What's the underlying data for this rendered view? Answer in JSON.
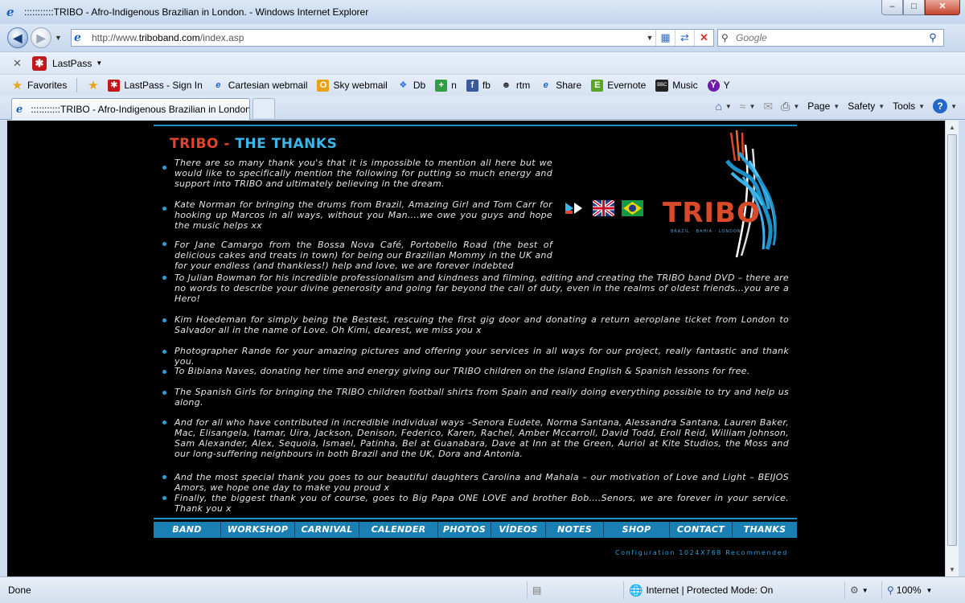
{
  "window": {
    "title": ":::::::::::TRIBO - Afro-Indigenous Brazilian in London. - Windows Internet Explorer",
    "buttons": {
      "minimize": "–",
      "maximize": "□",
      "close": "✕"
    }
  },
  "navbar": {
    "url_prefix": "http://www.",
    "url_domain": "triboband.com",
    "url_path": "/index.asp",
    "search_placeholder": "Google"
  },
  "lastpass": {
    "label": "LastPass"
  },
  "favorites": {
    "label": "Favorites",
    "items": [
      {
        "label": "LastPass - Sign In",
        "icon": "lastpass-icon"
      },
      {
        "label": "Cartesian webmail",
        "icon": "ie-page-icon"
      },
      {
        "label": "Sky webmail",
        "icon": "outlook-icon"
      },
      {
        "label": "Db",
        "icon": "dropbox-icon"
      },
      {
        "label": "n",
        "icon": "plus-icon"
      },
      {
        "label": "fb",
        "icon": "facebook-icon"
      },
      {
        "label": "rtm",
        "icon": "cow-icon"
      },
      {
        "label": "Share",
        "icon": "ie-page-icon"
      },
      {
        "label": "Evernote",
        "icon": "evernote-icon"
      },
      {
        "label": "Music",
        "icon": "bbc-icon"
      },
      {
        "label": "Y",
        "icon": "yahoo-icon"
      }
    ]
  },
  "tab": {
    "title": ":::::::::::TRIBO - Afro-Indigenous Brazilian in London..."
  },
  "commandbar": {
    "page": "Page",
    "safety": "Safety",
    "tools": "Tools"
  },
  "page": {
    "heading_part1": "TRIBO - ",
    "heading_part2": "THE THANKS",
    "logo_text": "TRIBO",
    "logo_subtext": "BRAZIL · BAHIA · LONDON",
    "thanks": [
      "There are so many thank you's that it is impossible to mention all here but we would like to specifically mention the following for putting so much energy and support into TRIBO and ultimately believing in the dream.",
      "Kate Norman for bringing the drums from Brazil, Amazing Girl and Tom Carr for hooking up Marcos in all ways, without you Man….we owe you guys and hope the music helps xx",
      "For Jane Camargo from the Bossa Nova Café, Portobello Road (the best of delicious cakes and treats in town) for being our Brazilian Mommy in the UK and for your endless (and thankless!) help and love, we are forever indebted",
      "To Julian Bowman for his incredible professionalism and kindness and filming, editing and creating the TRIBO band DVD – there are no words to describe your divine generosity and going far beyond the call of duty, even in the realms of oldest friends…you are a Hero!",
      "Kim Hoedeman for simply being the Bestest, rescuing the first gig door and donating a return aeroplane ticket from London to Salvador all in the name of Love. Oh Kimi, dearest, we miss you x",
      "Photographer Rande for your amazing pictures and offering your services in all ways for our project, really fantastic and thank you.",
      "To Bibiana Naves, donating her time and energy giving our TRIBO children on the island English & Spanish lessons for free.",
      "The Spanish Girls for bringing the TRIBO children football shirts from Spain and really doing everything possible to try and help us along.",
      "And for all who have contributed in incredible individual ways  –Senora Eudete, Norma Santana, Alessandra Santana, Lauren Baker, Mac, Elisangela, Itamar, Uira, Jackson, Denison, Federico, Karen, Rachel, Amber Mccarroll, David Todd, Eroll Reid, William Johnson, Sam Alexander, Alex, Sequoia, Ismael, Patinha, Bel at Guanabara, Dave at Inn at the Green, Auriol at Kite Studios, the Moss and our long-suffering neighbours in both Brazil and the UK, Dora and Antonia.",
      "And the most special thank you goes to our beautiful daughters Carolina and Mahala – our motivation of Love and Light – BEIJOS Amors, we hope one day to make you proud x",
      "Finally, the biggest thank you of course, goes to Big Papa ONE LOVE and brother Bob….Senors, we are forever in your service. Thank you x"
    ],
    "menu": [
      "BAND",
      "WORKSHOP",
      "CARNIVAL",
      "CALENDER",
      "PHOTOS",
      "VÍDEOS",
      "NOTES",
      "SHOP",
      "CONTACT",
      "THANKS"
    ],
    "config_note": "Configuration  1024X768  Recommended"
  },
  "statusbar": {
    "status": "Done",
    "zone": "Internet | Protected Mode: On",
    "zoom": "100%"
  },
  "colors": {
    "accent_blue": "#1a7fb3",
    "heading_red": "#e0442a",
    "heading_blue": "#3ab7ea"
  }
}
